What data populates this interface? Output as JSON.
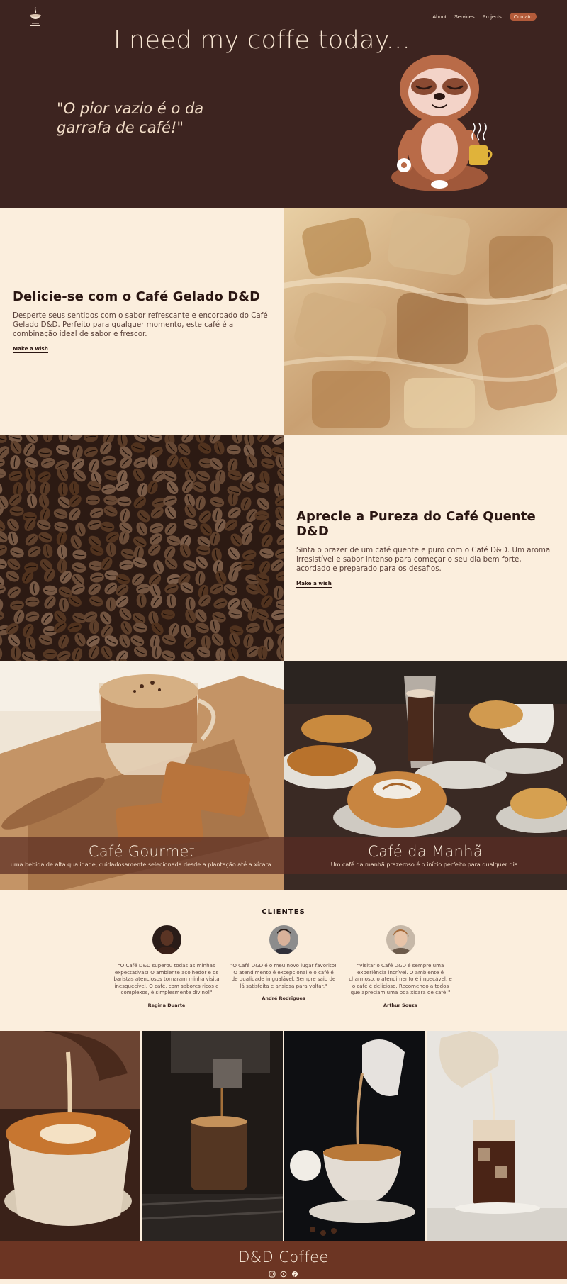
{
  "nav": {
    "items": [
      "About",
      "Services",
      "Projects",
      "Contato"
    ]
  },
  "hero": {
    "title": "I need my coffe today...",
    "quote": "\"O pior vazio é o da garrafa de café!\""
  },
  "feature1": {
    "title": "Delicie-se com o Café Gelado D&D",
    "text": "Desperte seus sentidos com o sabor refrescante e encorpado do Café Gelado D&D. Perfeito para qualquer momento, este café é a combinação ideal de sabor e frescor.",
    "link": "Make a wish"
  },
  "feature2": {
    "title": "Aprecie a Pureza do Café Quente D&D",
    "text": "Sinta o prazer de um café quente e puro com o Café D&D. Um aroma irresistível e sabor intenso para começar o seu dia bem forte, acordado e preparado para os desafios.",
    "link": "Make a wish"
  },
  "products": [
    {
      "title": "Café Gourmet",
      "text": "uma bebida de alta qualidade, cuidadosamente selecionada desde a plantação até a xícara."
    },
    {
      "title": "Café da Manhã",
      "text": "Um café da manhã prazeroso é o início perfeito para qualquer dia."
    }
  ],
  "clients": {
    "heading": "CLIENTES",
    "items": [
      {
        "quote": "\"O Café D&D superou todas as minhas expectativas! O ambiente acolhedor e os baristas atenciosos tornaram minha visita inesquecível. O café, com sabores ricos e complexos, é simplesmente divino!\"",
        "name": "Regina Duarte"
      },
      {
        "quote": "\"O Café D&D é o meu novo lugar favorito! O atendimento é excepcional e o café é de qualidade inigualável. Sempre saio de lá satisfeita e ansiosa para voltar.\"",
        "name": "André Rodrigues"
      },
      {
        "quote": "\"Visitar o Café D&D é sempre uma experiência incrível. O ambiente é charmoso, o atendimento é impecável, e o café é delicioso. Recomendo a todos que apreciam uma boa xícara de café!\"",
        "name": "Arthur Souza"
      }
    ]
  },
  "footer": {
    "brand": "D&D Coffee",
    "socials": [
      "instagram-icon",
      "whatsapp-icon",
      "pinterest-icon"
    ]
  },
  "colors": {
    "hero_bg": "#3d2420",
    "cream": "#fbeedd",
    "footer_bg": "#6c3523",
    "accent": "#b35b3a"
  }
}
